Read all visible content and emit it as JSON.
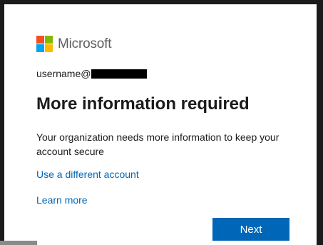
{
  "brand": {
    "name": "Microsoft",
    "icon": "microsoft-logo-icon"
  },
  "identity": {
    "username_prefix": "username@"
  },
  "title": "More information required",
  "description": "Your organization needs more information to keep your account secure",
  "links": {
    "different_account": "Use a different account",
    "learn_more": "Learn more"
  },
  "buttons": {
    "next": "Next"
  },
  "colors": {
    "accent": "#0067b8",
    "logo_red": "#f25022",
    "logo_green": "#7fba00",
    "logo_blue": "#00a4ef",
    "logo_yellow": "#ffb900"
  }
}
